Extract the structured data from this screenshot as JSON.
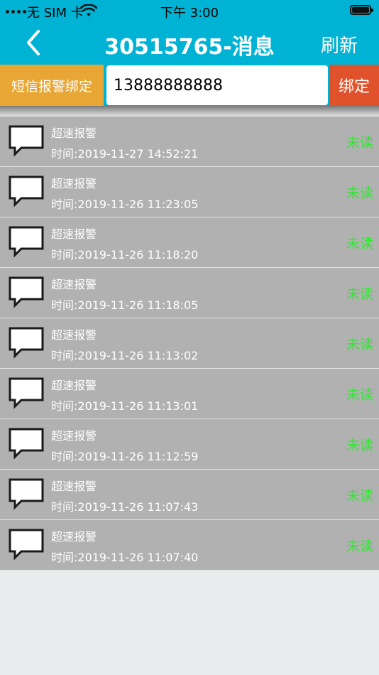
{
  "status_bar": {
    "carrier": "无 SIM 卡",
    "time": "下午 3:00"
  },
  "nav": {
    "title": "30515765-消息",
    "refresh_label": "刷新"
  },
  "sms_bind": {
    "label": "短信报警绑定",
    "phone_value": "13888888888",
    "bind_label": "绑定"
  },
  "messages": [
    {
      "type": "超速报警",
      "time": "时间:2019-11-27 14:52:21",
      "status": "未读"
    },
    {
      "type": "超速报警",
      "time": "时间:2019-11-26 11:23:05",
      "status": "未读"
    },
    {
      "type": "超速报警",
      "time": "时间:2019-11-26 11:18:20",
      "status": "未读"
    },
    {
      "type": "超速报警",
      "time": "时间:2019-11-26 11:18:05",
      "status": "未读"
    },
    {
      "type": "超速报警",
      "time": "时间:2019-11-26 11:13:02",
      "status": "未读"
    },
    {
      "type": "超速报警",
      "time": "时间:2019-11-26 11:13:01",
      "status": "未读"
    },
    {
      "type": "超速报警",
      "time": "时间:2019-11-26 11:12:59",
      "status": "未读"
    },
    {
      "type": "超速报警",
      "time": "时间:2019-11-26 11:07:43",
      "status": "未读"
    },
    {
      "type": "超速报警",
      "time": "时间:2019-11-26 11:07:40",
      "status": "未读"
    }
  ],
  "icons": {
    "back": "chevron-left-icon",
    "message": "speech-bubble-icon",
    "wifi": "wifi-icon",
    "battery": "battery-icon"
  },
  "colors": {
    "header": "#00b3d4",
    "bind_label_bg": "#e8a634",
    "bind_button_bg": "#e0522b",
    "row_bg": "#b1b1b1",
    "unread": "#2ee830"
  }
}
